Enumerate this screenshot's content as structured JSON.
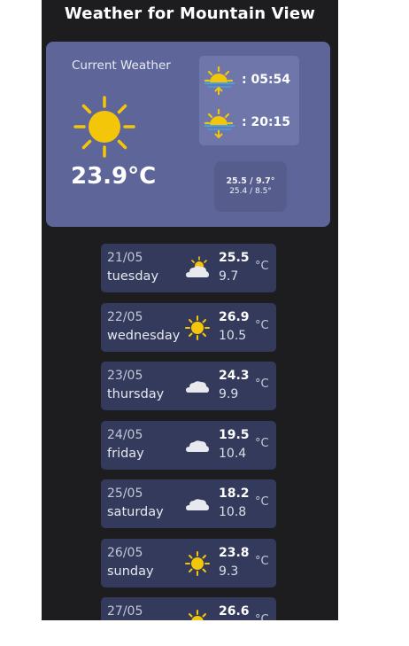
{
  "header": {
    "title": "Weather for Mountain View"
  },
  "current": {
    "label": "Current Weather",
    "temperature": "23.9°C",
    "icon": "sun-icon",
    "sunrise": ": 05:54",
    "sunset": ": 20:15",
    "minmax_line1": "25.5 / 9.7°",
    "minmax_line2": "25.4 / 8.5°"
  },
  "forecast": [
    {
      "date": "21/05",
      "day": "tuesday",
      "max": "25.5",
      "min": "9.7",
      "unit": "°C",
      "icon": "partly-cloudy-icon"
    },
    {
      "date": "22/05",
      "day": "wednesday",
      "max": "26.9",
      "min": "10.5",
      "unit": "°C",
      "icon": "sun-icon"
    },
    {
      "date": "23/05",
      "day": "thursday",
      "max": "24.3",
      "min": "9.9",
      "unit": "°C",
      "icon": "cloud-icon"
    },
    {
      "date": "24/05",
      "day": "friday",
      "max": "19.5",
      "min": "10.4",
      "unit": "°C",
      "icon": "cloud-icon"
    },
    {
      "date": "25/05",
      "day": "saturday",
      "max": "18.2",
      "min": "10.8",
      "unit": "°C",
      "icon": "cloud-icon"
    },
    {
      "date": "26/05",
      "day": "sunday",
      "max": "23.8",
      "min": "9.3",
      "unit": "°C",
      "icon": "sun-icon"
    },
    {
      "date": "27/05",
      "day": "",
      "max": "26.6",
      "min": "",
      "unit": "°C",
      "icon": "sun-icon"
    }
  ],
  "colors": {
    "background": "#1d1d20",
    "card": "#5d6599",
    "forecast_row": "#343a5b",
    "sun": "#f4c60a",
    "cloud": "#e8e9ee"
  }
}
